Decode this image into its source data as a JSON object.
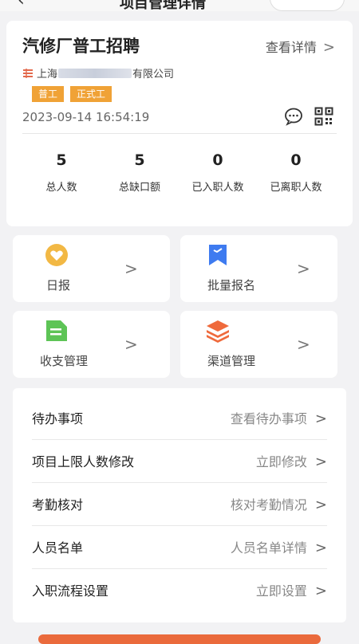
{
  "topbar": {
    "back": "‹",
    "title": "项目管理详情"
  },
  "header": {
    "job_title": "汽修厂普工招聘",
    "detail_link": "查看详情",
    "company_prefix": "上海",
    "company_suffix": "有限公司",
    "tags": [
      "普工",
      "正式工"
    ],
    "datetime": "2023-09-14 16:54:19"
  },
  "stats": [
    {
      "value": "5",
      "label": "总人数"
    },
    {
      "value": "5",
      "label": "总缺口额"
    },
    {
      "value": "0",
      "label": "已入职人数"
    },
    {
      "value": "0",
      "label": "已离职人数"
    }
  ],
  "tiles": [
    {
      "label": "日报",
      "icon": "heart-badge-icon",
      "color": "#f2b844"
    },
    {
      "label": "批量报名",
      "icon": "bookmark-icon",
      "color": "#3e7bf0"
    },
    {
      "label": "收支管理",
      "icon": "document-icon",
      "color": "#5dc456"
    },
    {
      "label": "渠道管理",
      "icon": "layers-icon",
      "color": "#ef6a3c"
    }
  ],
  "list": [
    {
      "label": "待办事项",
      "action": "查看待办事项"
    },
    {
      "label": "项目上限人数修改",
      "action": "立即修改"
    },
    {
      "label": "考勤核对",
      "action": "核对考勤情况"
    },
    {
      "label": "人员名单",
      "action": "人员名单详情"
    },
    {
      "label": "入职流程设置",
      "action": "立即设置"
    }
  ],
  "chevron": ">",
  "colors": {
    "accent": "#f0a236",
    "button": "#ea6a3c"
  }
}
